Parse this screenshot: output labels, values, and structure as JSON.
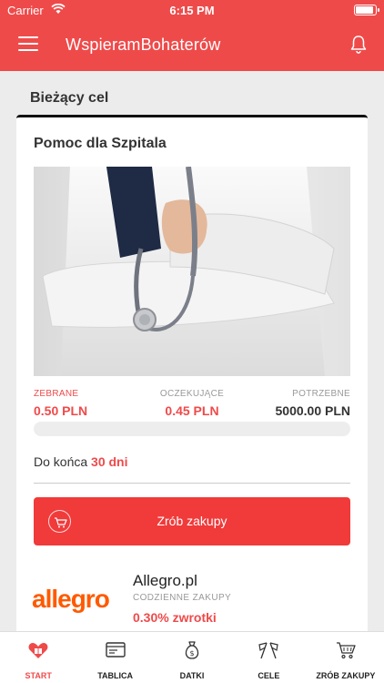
{
  "status_bar": {
    "carrier": "Carrier",
    "time": "6:15 PM",
    "battery_level": 0.9
  },
  "app_bar": {
    "title": "WspieramBohaterów",
    "menu_icon": "menu-icon",
    "bell_icon": "bell-icon"
  },
  "section": {
    "title": "Bieżący cel"
  },
  "goal": {
    "title": "Pomoc dla Szpitala",
    "image": "doctor-stethoscope-photo",
    "collected_label": "ZEBRANE",
    "collected_value": "0.50 PLN",
    "pending_label": "OCZEKUJĄCE",
    "pending_value": "0.45 PLN",
    "needed_label": "POTRZEBNE",
    "needed_value": "5000.00 PLN",
    "progress_fraction": 0.0001,
    "deadline_prefix": "Do końca",
    "deadline_days": "30 dni",
    "shop_button_label": "Zrób zakupy"
  },
  "store": {
    "logo_text": "allegro",
    "name": "Allegro.pl",
    "category": "CODZIENNE ZAKUPY",
    "cashback": "0.30% zwrotki"
  },
  "bottom_nav": [
    {
      "label": "START",
      "icon": "heart-gift-icon",
      "active": true
    },
    {
      "label": "TABLICA",
      "icon": "board-icon",
      "active": false
    },
    {
      "label": "DATKI",
      "icon": "money-bag-icon",
      "active": false
    },
    {
      "label": "CELE",
      "icon": "flags-icon",
      "active": false
    },
    {
      "label": "ZRÓB ZAKUPY",
      "icon": "shopping-cart-icon",
      "active": false
    }
  ],
  "colors": {
    "accent": "#ef4a4a",
    "allegro": "#ff5a00"
  }
}
